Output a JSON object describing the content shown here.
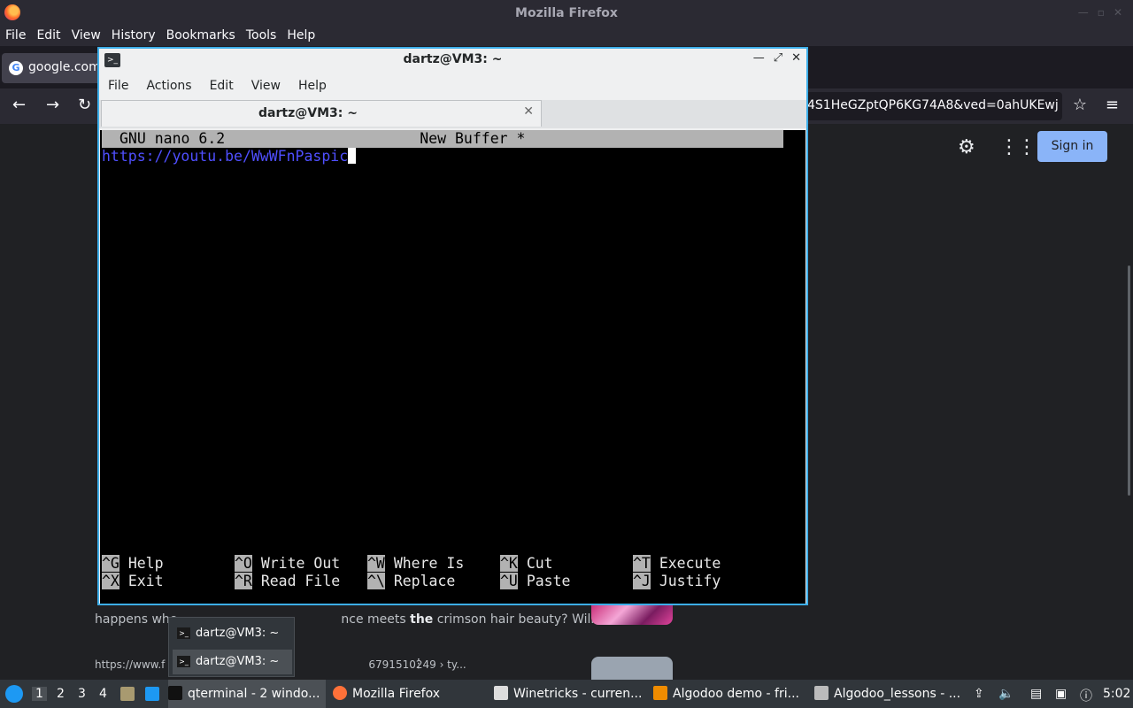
{
  "firefox": {
    "window_title": "Mozilla Firefox",
    "menu": [
      "File",
      "Edit",
      "View",
      "History",
      "Bookmarks",
      "Tools",
      "Help"
    ],
    "tab_label": "google.com",
    "url_visible": "4S1HeGZptQP6KG74A8&ved=0ahUKEwj",
    "sign_in": "Sign in",
    "snippet_pre": "happens whe",
    "snippet_mid": "nce meets ",
    "snippet_bold": "the",
    "snippet_post": " crimson hair beauty? Will he ...",
    "result_url_left": "https://www.f",
    "result_url_right": "6791510249 › ty..."
  },
  "terminal": {
    "window_title": "dartz@VM3: ~",
    "menu": [
      "File",
      "Actions",
      "Edit",
      "View",
      "Help"
    ],
    "tab_label": "dartz@VM3: ~",
    "nano_version": "GNU nano 6.2",
    "buffer_name": "New Buffer *",
    "buffer_text": "https://youtu.be/WwWFnPaspic",
    "shortcuts": [
      {
        "key": "^G",
        "label": "Help"
      },
      {
        "key": "^X",
        "label": "Exit"
      },
      {
        "key": "^O",
        "label": "Write Out"
      },
      {
        "key": "^R",
        "label": "Read File"
      },
      {
        "key": "^W",
        "label": "Where Is"
      },
      {
        "key": "^\\",
        "label": "Replace"
      },
      {
        "key": "^K",
        "label": "Cut"
      },
      {
        "key": "^U",
        "label": "Paste"
      },
      {
        "key": "^T",
        "label": "Execute"
      },
      {
        "key": "^J",
        "label": "Justify"
      }
    ]
  },
  "popup": {
    "items": [
      "dartz@VM3: ~",
      "dartz@VM3: ~"
    ]
  },
  "panel": {
    "desktops": [
      "1",
      "2",
      "3",
      "4"
    ],
    "tasks": [
      "qterminal - 2 windo...",
      "Mozilla Firefox",
      "Winetricks - curren...",
      "Algodoo demo - fri...",
      "Algodoo_lessons - ..."
    ],
    "clock": "5:02"
  },
  "colors": {
    "accent": "#3daee9",
    "nano_header_bg": "#b2b2b2",
    "nano_url": "#4f4fff",
    "google_signin": "#8ab4f8"
  }
}
